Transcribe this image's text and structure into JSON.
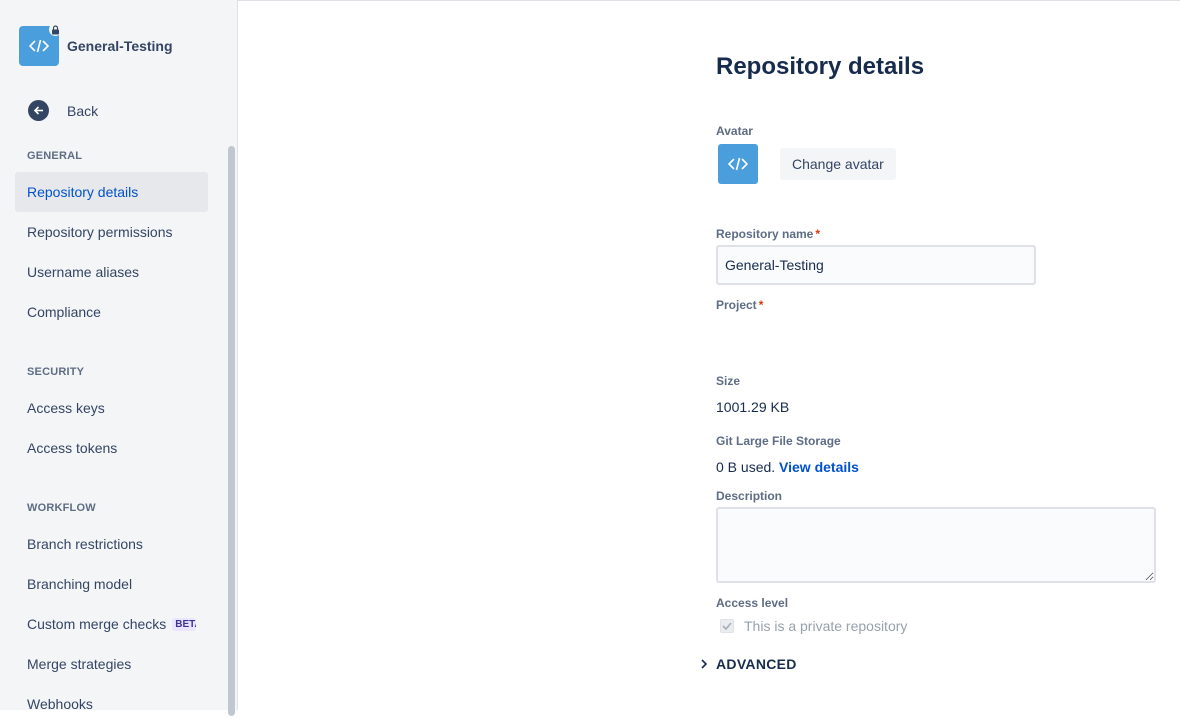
{
  "sidebar": {
    "repo_title": "General-Testing",
    "back_label": "Back",
    "sections": [
      {
        "heading": "GENERAL",
        "items": [
          "Repository details",
          "Repository permissions",
          "Username aliases",
          "Compliance"
        ]
      },
      {
        "heading": "SECURITY",
        "items": [
          "Access keys",
          "Access tokens"
        ]
      },
      {
        "heading": "WORKFLOW",
        "items": [
          "Branch restrictions",
          "Branching model",
          "Custom merge checks",
          "Merge strategies",
          "Webhooks"
        ]
      }
    ],
    "custom_merge_badge": "BETA",
    "active_item": "Repository details"
  },
  "main": {
    "title": "Repository details",
    "avatar_label": "Avatar",
    "change_avatar_button": "Change avatar",
    "repo_name_label": "Repository name",
    "repo_name_value": "General-Testing",
    "required_mark": "*",
    "project_label": "Project",
    "size_label": "Size",
    "size_value": "1001.29 KB",
    "lfs_label": "Git Large File Storage",
    "lfs_value": "0 B used.",
    "lfs_link": "View details",
    "description_label": "Description",
    "description_value": "",
    "access_level_label": "Access level",
    "private_checkbox_label": "This is a private repository",
    "private_checked": true,
    "advanced_label": "ADVANCED"
  },
  "colors": {
    "accent": "#0052cc",
    "avatar": "#4a9edb",
    "required": "#de350b"
  }
}
